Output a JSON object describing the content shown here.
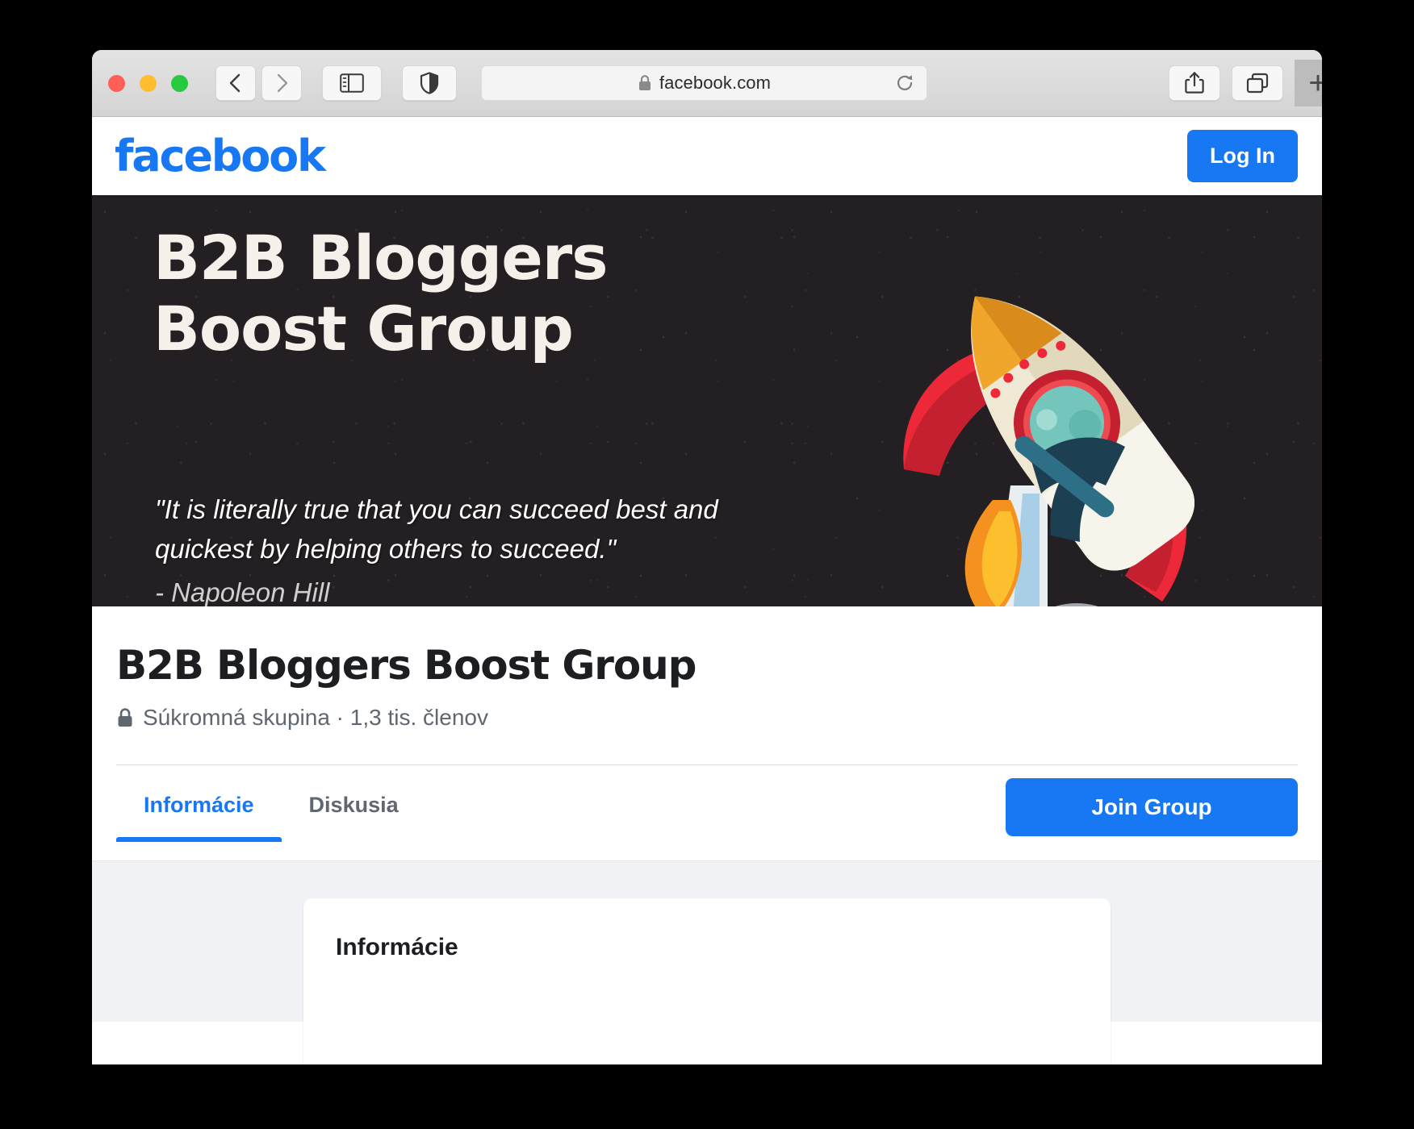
{
  "browser": {
    "url": "facebook.com",
    "lock_icon": "lock-icon",
    "back_icon": "chevron-left-icon",
    "forward_icon": "chevron-right-icon",
    "sidebar_icon": "sidebar-toggle-icon",
    "shield_icon": "privacy-shield-icon",
    "reload_icon": "reload-icon",
    "share_icon": "share-icon",
    "tabs_icon": "tab-overview-icon",
    "new_tab_label": "+"
  },
  "fb_header": {
    "logo": "facebook",
    "login_label": "Log In"
  },
  "cover": {
    "headline": "B2B Bloggers\nBoost Group",
    "quote": "\"It is literally true that you can succeed best and quickest by helping others to succeed.\"",
    "attribution": "- Napoleon Hill",
    "illustration": "rocket-illustration",
    "background_color": "#241f22"
  },
  "group": {
    "title": "B2B Bloggers Boost Group",
    "privacy_icon": "lock-icon",
    "meta": "Súkromná skupina · 1,3 tis. členov"
  },
  "tabs": [
    {
      "label": "Informácie",
      "active": true
    },
    {
      "label": "Diskusia",
      "active": false
    }
  ],
  "actions": {
    "join_label": "Join Group"
  },
  "content": {
    "card_title": "Informácie"
  },
  "colors": {
    "accent": "#1877f2",
    "page_bg": "#f0f2f5",
    "muted_text": "#606770"
  }
}
